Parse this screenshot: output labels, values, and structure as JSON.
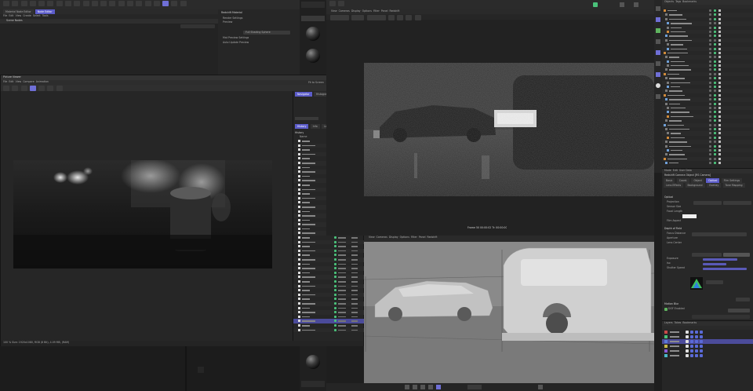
{
  "top_left": {
    "tabs": [
      "Material Node Editor",
      "Node Editor"
    ],
    "title": "Scene Nodes",
    "menu": [
      "File",
      "Edit",
      "View",
      "Create",
      "Select",
      "Tools"
    ],
    "attr_title": "Redshift Material",
    "attr_rows": [
      "Render Settings",
      "Preview",
      "Full Shading Sphere",
      "Mat Preview Settings",
      "Auto Update Preview"
    ]
  },
  "picture_viewer": {
    "title": "Picture Viewer",
    "menu": [
      "File",
      "Edit",
      "View",
      "Compare",
      "Animation"
    ],
    "zoom_label": "Fit to Screen",
    "zoom_value": "100 %",
    "tabs_top": [
      "Navigator",
      "Histogram"
    ],
    "tabs_mid": [
      "History",
      "Info",
      "Layer",
      "Filter",
      "Stereo"
    ],
    "list_header": "History",
    "col_headers": [
      "Name",
      "Render Time",
      "R",
      "Res"
    ],
    "status": "100 %    Size: 1920x1080, RGB (8 Bit), 4.09 MB, (RAM)",
    "history_count": 44,
    "selected_row": 41
  },
  "viewport_top": {
    "menu": [
      "View",
      "Cameras",
      "Display",
      "Options",
      "Filter",
      "Panel",
      "Redshift"
    ],
    "caption": "Frame 50  00:00:02  Tr: 00:00:00"
  },
  "viewport_bottom": {
    "menu": [
      "View",
      "Cameras",
      "Display",
      "Options",
      "Filter",
      "Panel",
      "Redshift"
    ]
  },
  "objects": {
    "header": [
      "Objects",
      "Tags",
      "Bookmarks"
    ],
    "count": 37
  },
  "attributes": {
    "tabs": [
      "Mode",
      "Edit",
      "User Data"
    ],
    "title": "Redshift Camera Object [RS Camera]",
    "subtabs": [
      "Basic",
      "Coord.",
      "Object",
      "Optical",
      "Film Settings",
      "Lens Effects",
      "Background",
      "Overlay",
      "Tone Mapping"
    ],
    "sections": [
      "Optical",
      "Depth of Field",
      "Motion Blur"
    ],
    "rows": [
      "Projection",
      "Sensor Size",
      "Focal Length",
      "Film Aspect",
      "Focus Distance",
      "Aperture",
      "Lens Center",
      "Exposure",
      "Iso",
      "Shutter Speed"
    ],
    "checkbox_label": "DOF Enabled"
  },
  "layers": {
    "header": [
      "Layers",
      "Takes",
      "Bookmarks"
    ],
    "count": 6
  },
  "colors": {
    "accent": "#6f6fd6",
    "check_green": "#4ac27a",
    "panel": "#2b2b2b",
    "bg": "#1e1e1e"
  }
}
